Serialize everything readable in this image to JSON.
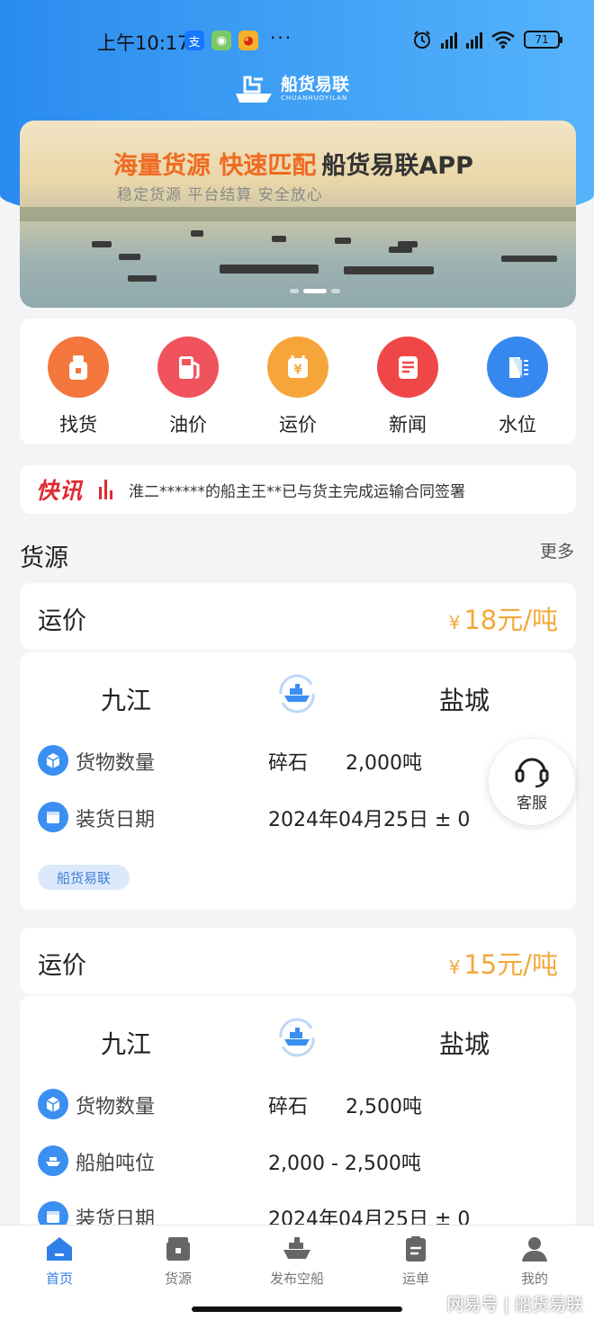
{
  "status_bar": {
    "time": "上午10:17",
    "dots": "···",
    "battery": "71"
  },
  "app": {
    "logo_title": "船货易联",
    "logo_sub": "CHUANHUOYILAN"
  },
  "banner": {
    "headline_orange": "海量货源 快速匹配",
    "headline_dark": "船货易联APP",
    "subline": "稳定货源  平台结算  安全放心"
  },
  "quick_nav": [
    {
      "label": "找货",
      "color": "#f3773c",
      "icon": "cargo-bag-icon"
    },
    {
      "label": "油价",
      "color": "#f0535b",
      "icon": "fuel-pump-icon"
    },
    {
      "label": "运价",
      "color": "#f6a53a",
      "icon": "price-tag-icon"
    },
    {
      "label": "新闻",
      "color": "#ef4747",
      "icon": "news-icon"
    },
    {
      "label": "水位",
      "color": "#3688ef",
      "icon": "water-level-icon"
    }
  ],
  "news": {
    "tag": "快讯",
    "text": "淮二******的船主王**已与货主完成运输合同签署"
  },
  "section": {
    "title": "货源",
    "more": "更多"
  },
  "listings": [
    {
      "price_label": "运价",
      "currency": "¥",
      "price": "18元/吨",
      "from": "九江",
      "to": "盐城",
      "rows": [
        {
          "icon": "cargo-box-icon",
          "label": "货物数量",
          "value": "碎石      2,000吨"
        },
        {
          "icon": "calendar-icon",
          "label": "装货日期",
          "value": "2024年04月25日 ± 0"
        }
      ],
      "tag": "船货易联"
    },
    {
      "price_label": "运价",
      "currency": "¥",
      "price": "15元/吨",
      "from": "九江",
      "to": "盐城",
      "rows": [
        {
          "icon": "cargo-box-icon",
          "label": "货物数量",
          "value": "碎石      2,500吨"
        },
        {
          "icon": "ship-icon",
          "label": "船舶吨位",
          "value": "2,000 - 2,500吨"
        },
        {
          "icon": "calendar-icon",
          "label": "装货日期",
          "value": "2024年04月25日 ± 0"
        }
      ]
    }
  ],
  "service": {
    "label": "客服"
  },
  "tabbar": [
    {
      "label": "首页",
      "icon": "home-icon",
      "active": true
    },
    {
      "label": "货源",
      "icon": "cargo-source-icon",
      "active": false
    },
    {
      "label": "发布空船",
      "icon": "publish-ship-icon",
      "active": false
    },
    {
      "label": "运单",
      "icon": "waybill-icon",
      "active": false
    },
    {
      "label": "我的",
      "icon": "profile-icon",
      "active": false
    }
  ],
  "watermark": "网易号 | 船货易联",
  "colors": {
    "accent_blue": "#2f7fe8",
    "price_orange": "#f2a93b",
    "news_red": "#e02a32"
  }
}
